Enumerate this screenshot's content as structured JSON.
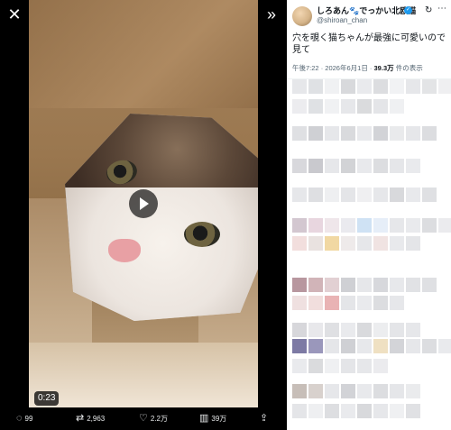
{
  "window": {
    "close_icon": "close-icon",
    "expand_icon": "collapse-panel-icon"
  },
  "video": {
    "duration": "0:23",
    "play_icon": "play-icon"
  },
  "actions": {
    "reply_count": "99",
    "retweet_count": "2,963",
    "like_count": "2.2万",
    "view_count": "39万"
  },
  "tweet": {
    "display_name": "しろあん🐾でっかい北欧猫",
    "handle": "@shiroan_chan",
    "verified": true,
    "text": "穴を覗く猫ちゃんが最強に可愛いので見て",
    "time": "午後7:22",
    "date": "2026年6月1日",
    "views": "39.3万",
    "views_suffix": "件の表示",
    "separator": "·"
  },
  "colors": {
    "accent": "#1d9bf0",
    "dark_bg": "#000000",
    "panel_bg": "#ffffff"
  }
}
